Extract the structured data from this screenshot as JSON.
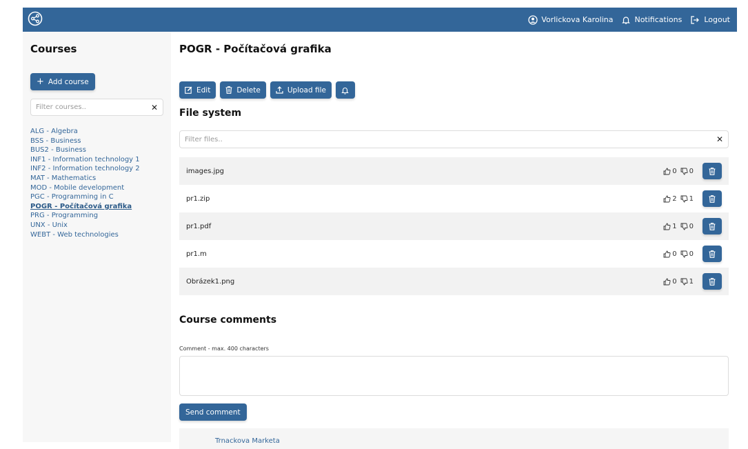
{
  "header": {
    "logo_icon": "share-icon",
    "user_name": "Vorlickova Karolina",
    "notifications_label": "Notifications",
    "logout_label": "Logout",
    "brand_color": "#336699"
  },
  "sidebar": {
    "title": "Courses",
    "add_course_label": "Add course",
    "filter_placeholder": "Filter courses..",
    "courses": [
      {
        "label": "ALG - Algebra",
        "active": false
      },
      {
        "label": "BSS - Business",
        "active": false
      },
      {
        "label": "BUS2 - Business",
        "active": false
      },
      {
        "label": "INF1 - Information technology 1",
        "active": false
      },
      {
        "label": "INF2 - Information technology 2",
        "active": false
      },
      {
        "label": "MAT - Mathematics",
        "active": false
      },
      {
        "label": "MOD - Mobile development",
        "active": false
      },
      {
        "label": "PGC - Programming in C",
        "active": false
      },
      {
        "label": "POGR - Počítačová grafika",
        "active": true
      },
      {
        "label": "PRG - Programming",
        "active": false
      },
      {
        "label": "UNX - Unix",
        "active": false
      },
      {
        "label": "WEBT - Web technologies",
        "active": false
      }
    ]
  },
  "main": {
    "title": "POGR - Počítačová grafika",
    "actions": {
      "edit_label": "Edit",
      "delete_label": "Delete",
      "upload_label": "Upload file"
    },
    "file_system_title": "File system",
    "file_filter_placeholder": "Filter files..",
    "files": [
      {
        "name": "images.jpg",
        "likes": "0",
        "dislikes": "0"
      },
      {
        "name": "pr1.zip",
        "likes": "2",
        "dislikes": "1"
      },
      {
        "name": "pr1.pdf",
        "likes": "1",
        "dislikes": "0"
      },
      {
        "name": "pr1.m",
        "likes": "0",
        "dislikes": "0"
      },
      {
        "name": "Obrázek1.png",
        "likes": "0",
        "dislikes": "1"
      }
    ],
    "comments_title": "Course comments",
    "comment_label": "Comment - max. 400 characters",
    "send_label": "Send comment",
    "comments": [
      {
        "author": "Trnackova Marketa"
      }
    ]
  }
}
